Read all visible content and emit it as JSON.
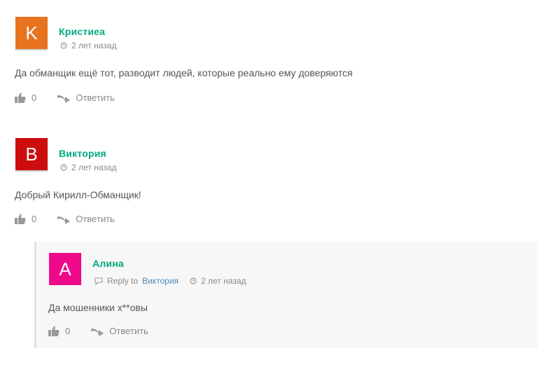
{
  "comments": [
    {
      "author": "Кристиеа",
      "initial": "K",
      "avatar_color": "#e8731f",
      "time": "2 лет назад",
      "text": "Да обманщик ещё тот, разводит людей, которые реально ему доверяются",
      "votes": "0",
      "reply_label": "Ответить"
    },
    {
      "author": "Виктория",
      "initial": "B",
      "avatar_color": "#cc0e0e",
      "time": "2 лет назад",
      "text": "Добрый Кирилл-Обманщик!",
      "votes": "0",
      "reply_label": "Ответить"
    }
  ],
  "reply_comment": {
    "author": "Алина",
    "initial": "A",
    "avatar_color": "#f0098a",
    "reply_to_label": "Reply to",
    "reply_to_name": "Виктория",
    "time": "2 лет назад",
    "text": "Да мошенники х**овы",
    "votes": "0",
    "reply_label": "Ответить"
  },
  "colors": {
    "author": "#00a97f",
    "link": "#4b8bbe",
    "muted": "#888888"
  }
}
